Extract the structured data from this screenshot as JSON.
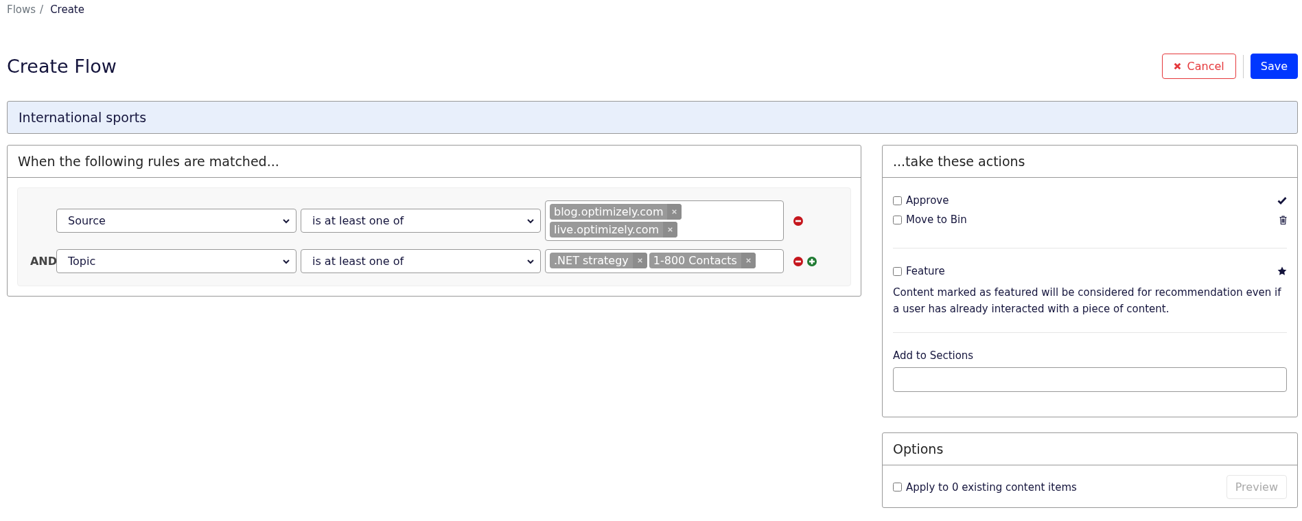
{
  "breadcrumb": {
    "separator": "/",
    "items": [
      {
        "label": "Flows"
      },
      {
        "label": "Create"
      }
    ]
  },
  "page_title": "Create Flow",
  "header_buttons": {
    "cancel": "Cancel",
    "save": "Save"
  },
  "flow_name": "International sports",
  "rules_panel": {
    "title": "When the following rules are matched...",
    "rules": [
      {
        "field": "Source",
        "operator": "is at least one of",
        "values": [
          "blog.optimizely.com",
          "live.optimizely.com"
        ],
        "can_add": false
      },
      {
        "connector": "AND",
        "field": "Topic",
        "operator": "is at least one of",
        "values": [
          ".NET strategy",
          "1-800 Contacts"
        ],
        "can_add": true
      }
    ]
  },
  "actions_panel": {
    "title": "...take these actions",
    "groups": [
      [
        {
          "label": "Approve",
          "checked": false,
          "kind": "check"
        },
        {
          "label": "Move to Bin",
          "checked": false,
          "kind": "trash"
        }
      ],
      [
        {
          "label": "Feature",
          "checked": false,
          "kind": "star",
          "description": "Content marked as featured will be considered for recommendation even if a user has already interacted with a piece of content."
        }
      ]
    ],
    "sections_label": "Add to Sections"
  },
  "options_panel": {
    "title": "Options",
    "apply_label": "Apply to 0 existing content items",
    "apply_checked": false,
    "preview_button": {
      "label": "Preview",
      "disabled": true
    }
  }
}
